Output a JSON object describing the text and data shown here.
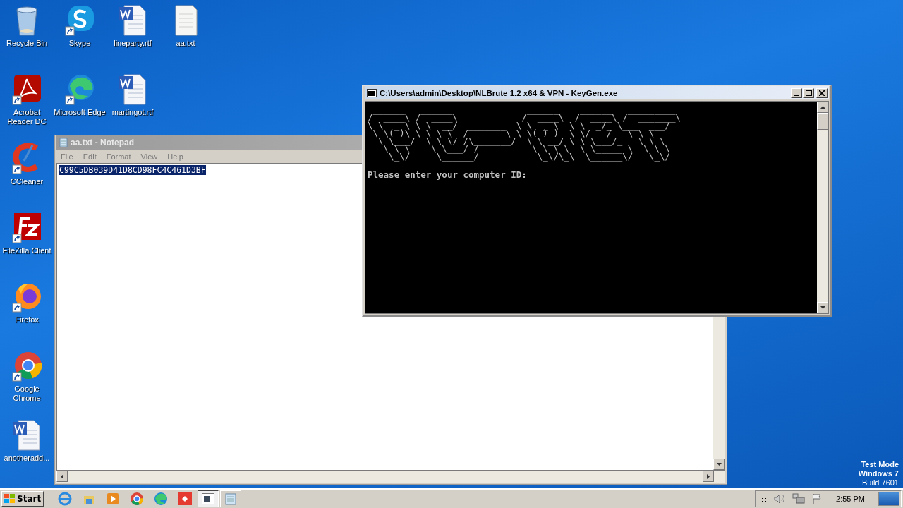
{
  "desktop_icons": [
    {
      "label": "Recycle Bin",
      "kind": "recycle"
    },
    {
      "label": "Skype",
      "kind": "skype"
    },
    {
      "label": "lineparty.rtf",
      "kind": "word"
    },
    {
      "label": "aa.txt",
      "kind": "text"
    },
    {
      "label": "Acrobat Reader DC",
      "kind": "acrobat"
    },
    {
      "label": "Microsoft Edge",
      "kind": "edge"
    },
    {
      "label": "martingot.rtf",
      "kind": "word"
    },
    {
      "label": "CCleaner",
      "kind": "ccleaner"
    },
    {
      "label": "FileZilla Client",
      "kind": "filezilla"
    },
    {
      "label": "Firefox",
      "kind": "firefox"
    },
    {
      "label": "Google Chrome",
      "kind": "chrome"
    },
    {
      "label": "anotheradd...",
      "kind": "word"
    }
  ],
  "notepad": {
    "title": "aa.txt - Notepad",
    "menu": [
      "File",
      "Edit",
      "Format",
      "View",
      "Help"
    ],
    "content": "C99C5DB039D41D8CD98FC4C461D3BF",
    "content_selected": true
  },
  "console": {
    "title": "C:\\Users\\admin\\Desktop\\NLBrute 1.2 x64 & VPN - KeyGen.exe",
    "ascii_art": [
      " ______   ______              ______    ______   _________",
      "/  ____\\ /  ____\\            /  ____\\  /  ____\\ /  _______\\",
      "\\ \\  _ \\ \\ \\  __/  _______  \\ \\  _ \\  \\ \\  _/_ \\___  ___/",
      " \\ \\(_)\\ \\ \\ \\ \\__/_______\\ \\ \\(_) )_ \\ \\/___/   \\ \\ \\",
      "  \\ \\___/  \\ \\ \\/ /\\_______/  \\ \\ __/ \\ \\ \\___/_   \\ \\ \\",
      "   \\ \\ \\    \\ \\___/ /          \\ \\ \\ \\  \\ \\_____ \\  \\ \\ \\",
      "    \\_\\/     \\______/           \\_\\/\\_\\  \\______\\/   \\_\\/"
    ],
    "prompt": "Please enter your computer ID:"
  },
  "system_info": [
    "Test Mode",
    "Windows 7",
    "Build 7601"
  ],
  "taskbar": {
    "start": "Start",
    "quick_launch": [
      {
        "kind": "ie"
      },
      {
        "kind": "explorer"
      },
      {
        "kind": "media"
      },
      {
        "kind": "chrome"
      },
      {
        "kind": "edge"
      },
      {
        "kind": "anydesk"
      }
    ],
    "tasks": [
      {
        "kind": "console",
        "selected": true
      },
      {
        "kind": "notepad",
        "selected": false
      }
    ],
    "clock": "2:55 PM"
  }
}
